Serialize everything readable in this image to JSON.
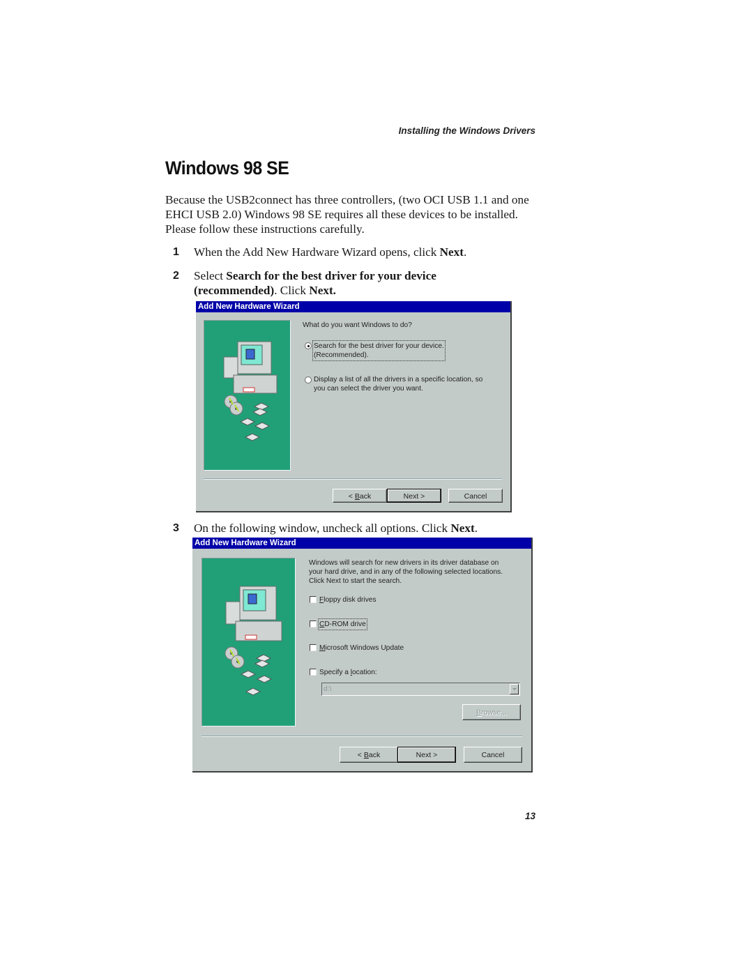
{
  "page": {
    "running_head": "Installing the Windows Drivers",
    "title": "Windows 98 SE",
    "intro": "Because the USB2connect has three controllers, (two OCI USB 1.1 and one EHCI USB 2.0) Windows 98 SE requires all these devices to be installed. Please follow these instructions carefully.",
    "steps": [
      {
        "num": "1",
        "pre": "When the Add New Hardware Wizard opens, click ",
        "bold": "Next",
        "post": "."
      },
      {
        "num": "2",
        "pre": "Select ",
        "bold": "Search for the best driver for your device (recommended)",
        "mid": ". Click ",
        "bold2": "Next.",
        "post": ""
      },
      {
        "num": "3",
        "pre": "On the following window, uncheck all options. Click ",
        "bold": "Next",
        "post": "."
      }
    ],
    "page_number": "13"
  },
  "dialog1": {
    "title": "Add New Hardware Wizard",
    "prompt": "What do you want Windows to do?",
    "options": [
      {
        "line1": "Search for the best driver for your device.",
        "line2": "(Recommended).",
        "selected": true
      },
      {
        "line1": "Display a list of all the drivers in a specific location, so",
        "line2": "you can select the driver you want.",
        "selected": false
      }
    ],
    "buttons": {
      "back_prefix": "< ",
      "back_key": "B",
      "back_rest": "ack",
      "next": "Next >",
      "cancel": "Cancel"
    }
  },
  "dialog2": {
    "title": "Add New Hardware Wizard",
    "description": [
      "Windows will search for new drivers in its driver database on",
      "your hard drive, and in any of the following selected locations.",
      "Click Next to start the search."
    ],
    "checkboxes": [
      {
        "key": "F",
        "rest": "loppy disk drives",
        "checked": false
      },
      {
        "key": "C",
        "rest": "D-ROM drive",
        "checked": false
      },
      {
        "key": "M",
        "rest": "icrosoft Windows Update",
        "checked": false
      },
      {
        "pre": "Specify a ",
        "key": "l",
        "rest": "ocation:",
        "checked": false
      }
    ],
    "location_value": "d:\\",
    "browse": {
      "key": "B",
      "rest": "rowse..."
    },
    "buttons": {
      "back_prefix": "< ",
      "back_key": "B",
      "back_rest": "ack",
      "next": "Next >",
      "cancel": "Cancel"
    }
  },
  "colors": {
    "titlebar": "#0000a8",
    "dialog_bg": "#c3cbc9",
    "panel_green": "#21a078"
  }
}
